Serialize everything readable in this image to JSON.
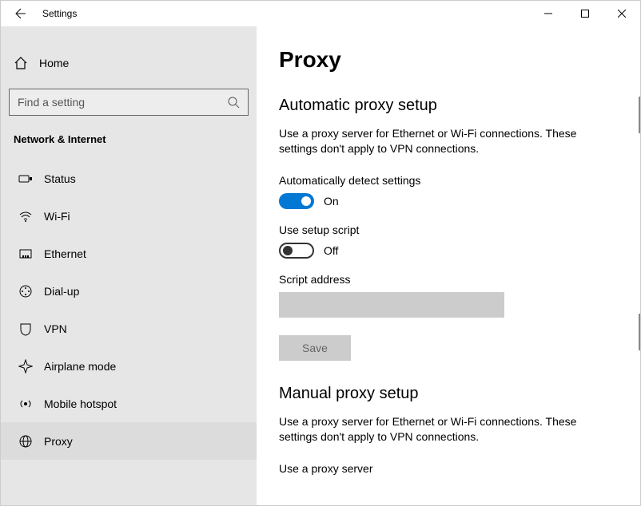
{
  "window": {
    "title": "Settings"
  },
  "sidebar": {
    "home_label": "Home",
    "search_placeholder": "Find a setting",
    "category": "Network & Internet",
    "items": [
      {
        "label": "Status"
      },
      {
        "label": "Wi-Fi"
      },
      {
        "label": "Ethernet"
      },
      {
        "label": "Dial-up"
      },
      {
        "label": "VPN"
      },
      {
        "label": "Airplane mode"
      },
      {
        "label": "Mobile hotspot"
      },
      {
        "label": "Proxy"
      }
    ]
  },
  "main": {
    "title": "Proxy",
    "auto": {
      "heading": "Automatic proxy setup",
      "desc": "Use a proxy server for Ethernet or Wi-Fi connections. These settings don't apply to VPN connections.",
      "detect_label": "Automatically detect settings",
      "detect_state": "On",
      "script_toggle_label": "Use setup script",
      "script_toggle_state": "Off",
      "script_address_label": "Script address",
      "script_address_value": "",
      "save_label": "Save"
    },
    "manual": {
      "heading": "Manual proxy setup",
      "desc": "Use a proxy server for Ethernet or Wi-Fi connections. These settings don't apply to VPN connections.",
      "use_label": "Use a proxy server"
    }
  }
}
